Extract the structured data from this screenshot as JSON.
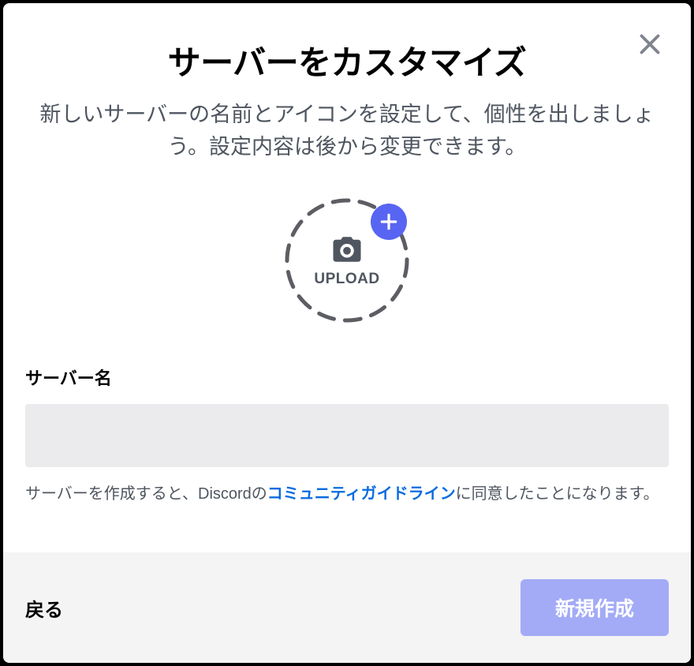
{
  "modal": {
    "title": "サーバーをカスタマイズ",
    "subtitle": "新しいサーバーの名前とアイコンを設定して、個性を出しましょう。設定内容は後から変更できます。",
    "upload_label": "UPLOAD",
    "field_label": "サーバー名",
    "server_name_value": "",
    "guidelines_prefix": "サーバーを作成すると、Discordの",
    "guidelines_link_text": "コミュニティガイドライン",
    "guidelines_suffix": "に同意したことになります。"
  },
  "footer": {
    "back_label": "戻る",
    "create_label": "新規作成"
  },
  "colors": {
    "accent": "#5865f2",
    "link": "#0a6ce0",
    "create_button": "#a3abf6"
  }
}
